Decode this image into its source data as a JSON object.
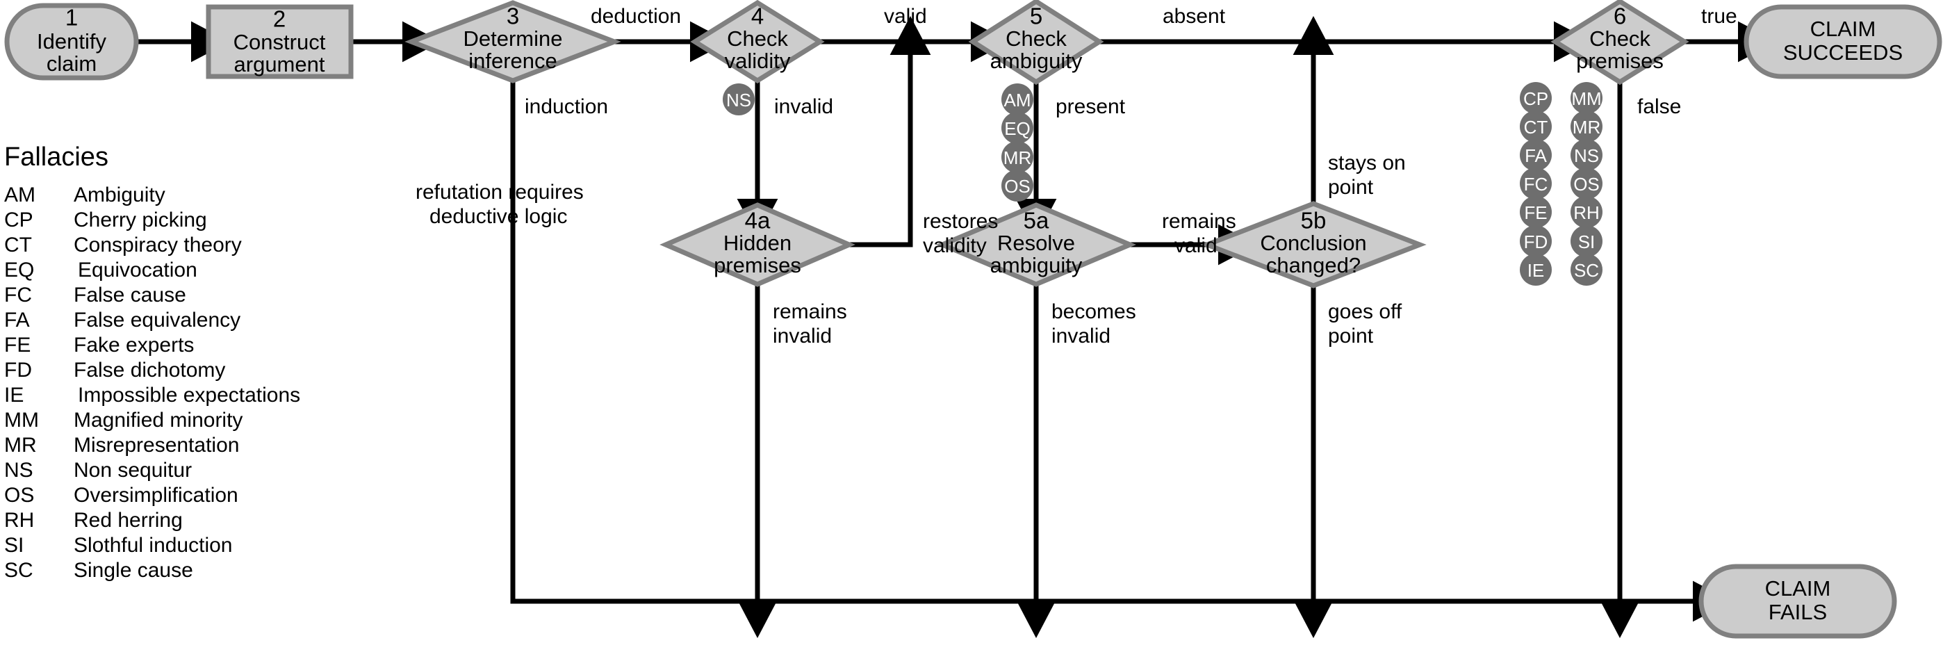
{
  "diagram": {
    "title_legend": "Fallacies",
    "colors": {
      "node_fill": "#cccccc",
      "node_stroke": "#808080",
      "badge_fill": "#6e6e6e",
      "badge_text": "#ffffff",
      "edge": "#000000",
      "background": "#ffffff"
    },
    "nodes": [
      {
        "id": "n1",
        "num": "1",
        "line1": "Identify",
        "line2": "claim",
        "shape": "stadium"
      },
      {
        "id": "n2",
        "num": "2",
        "line1": "Construct",
        "line2": "argument",
        "shape": "rect"
      },
      {
        "id": "n3",
        "num": "3",
        "line1": "Determine",
        "line2": "inference",
        "shape": "diamond"
      },
      {
        "id": "n4",
        "num": "4",
        "line1": "Check",
        "line2": "validity",
        "shape": "diamond"
      },
      {
        "id": "n4a",
        "num": "4a",
        "line1": "Hidden",
        "line2": "premises",
        "shape": "diamond"
      },
      {
        "id": "n5",
        "num": "5",
        "line1": "Check",
        "line2": "ambiguity",
        "shape": "diamond"
      },
      {
        "id": "n5a",
        "num": "5a",
        "line1": "Resolve",
        "line2": "ambiguity",
        "shape": "diamond"
      },
      {
        "id": "n5b",
        "num": "5b",
        "line1": "Conclusion",
        "line2": "changed?",
        "shape": "diamond"
      },
      {
        "id": "n6",
        "num": "6",
        "line1": "Check",
        "line2": "premises",
        "shape": "diamond"
      },
      {
        "id": "succ",
        "num": "",
        "line1": "CLAIM",
        "line2": "SUCCEEDS",
        "shape": "stadium"
      },
      {
        "id": "fail",
        "num": "",
        "line1": "CLAIM",
        "line2": "FAILS",
        "shape": "stadium"
      }
    ],
    "edge_labels": [
      {
        "id": "e_deduction",
        "text": "deduction"
      },
      {
        "id": "e_induction",
        "text": "induction"
      },
      {
        "id": "e_refutation",
        "line1": "refutation requires",
        "line2": "deductive logic"
      },
      {
        "id": "e_valid",
        "text": "valid"
      },
      {
        "id": "e_invalid",
        "text": "invalid"
      },
      {
        "id": "e_restores",
        "line1": "restores",
        "line2": "validity"
      },
      {
        "id": "e_remains_invalid",
        "line1": "remains",
        "line2": "invalid"
      },
      {
        "id": "e_absent",
        "text": "absent"
      },
      {
        "id": "e_present",
        "text": "present"
      },
      {
        "id": "e_becomes_invalid",
        "line1": "becomes",
        "line2": "invalid"
      },
      {
        "id": "e_remains_valid",
        "line1": "remains",
        "line2": "valid"
      },
      {
        "id": "e_stays_on_point",
        "line1": "stays on",
        "line2": "point"
      },
      {
        "id": "e_goes_off_point",
        "line1": "goes off",
        "line2": "point"
      },
      {
        "id": "e_true",
        "text": "true"
      },
      {
        "id": "e_false",
        "text": "false"
      }
    ],
    "badge_groups": [
      {
        "id": "badges-validity",
        "items": [
          "NS"
        ]
      },
      {
        "id": "badges-ambiguity",
        "items": [
          "AM",
          "EQ",
          "MR",
          "OS"
        ]
      },
      {
        "id": "badges-premises-col1",
        "items": [
          "CP",
          "CT",
          "FA",
          "FC",
          "FE",
          "FD",
          "IE"
        ]
      },
      {
        "id": "badges-premises-col2",
        "items": [
          "MM",
          "MR",
          "NS",
          "OS",
          "RH",
          "SI",
          "SC"
        ]
      }
    ],
    "legend": [
      {
        "abbr": "AM",
        "name": "Ambiguity"
      },
      {
        "abbr": "CP",
        "name": "Cherry picking"
      },
      {
        "abbr": "CT",
        "name": "Conspiracy theory"
      },
      {
        "abbr": "EQ",
        "name": "Equivocation"
      },
      {
        "abbr": "FC",
        "name": "False cause"
      },
      {
        "abbr": "FA",
        "name": "False equivalency"
      },
      {
        "abbr": "FE",
        "name": "Fake experts"
      },
      {
        "abbr": "FD",
        "name": "False dichotomy"
      },
      {
        "abbr": "IE",
        "name": "Impossible expectations"
      },
      {
        "abbr": "MM",
        "name": "Magnified minority"
      },
      {
        "abbr": "MR",
        "name": "Misrepresentation"
      },
      {
        "abbr": "NS",
        "name": "Non sequitur"
      },
      {
        "abbr": "OS",
        "name": "Oversimplification"
      },
      {
        "abbr": "RH",
        "name": "Red herring"
      },
      {
        "abbr": "SI",
        "name": "Slothful induction"
      },
      {
        "abbr": "SC",
        "name": "Single cause"
      }
    ]
  }
}
